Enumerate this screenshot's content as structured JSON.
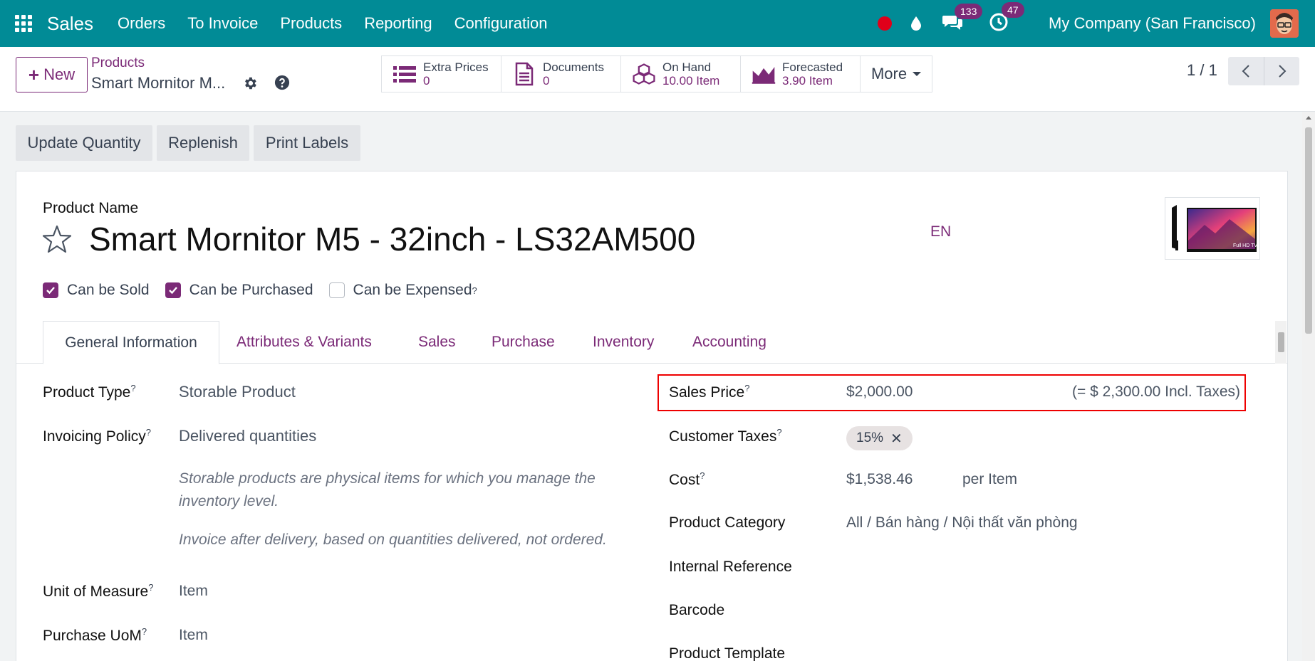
{
  "navbar": {
    "app_name": "Sales",
    "menu": [
      "Orders",
      "To Invoice",
      "Products",
      "Reporting",
      "Configuration"
    ],
    "messages_count": "133",
    "activities_count": "47",
    "company": "My Company (San Francisco)"
  },
  "control": {
    "new_label": "New",
    "breadcrumb_parent": "Products",
    "breadcrumb_current": "Smart Mornitor M...",
    "smart_buttons": [
      {
        "label": "Extra Prices",
        "value": "0",
        "icon": "list-icon"
      },
      {
        "label": "Documents",
        "value": "0",
        "icon": "document-icon"
      },
      {
        "label": "On Hand",
        "value": "10.00 Item",
        "icon": "cubes-icon"
      },
      {
        "label": "Forecasted",
        "value": "3.90 Item",
        "icon": "area-chart-icon"
      }
    ],
    "more_label": "More",
    "pager": "1 / 1"
  },
  "actions": [
    "Update Quantity",
    "Replenish",
    "Print Labels"
  ],
  "form": {
    "product_name_label": "Product Name",
    "product_name": "Smart Mornitor M5 - 32inch - LS32AM500",
    "lang": "EN",
    "image_caption": "Full HD TV",
    "checkboxes": [
      {
        "label": "Can be Sold",
        "checked": true
      },
      {
        "label": "Can be Purchased",
        "checked": true
      },
      {
        "label": "Can be Expensed",
        "checked": false
      }
    ],
    "tabs": [
      "General Information",
      "Attributes & Variants",
      "Sales",
      "Purchase",
      "Inventory",
      "Accounting"
    ],
    "left": {
      "product_type_label": "Product Type",
      "product_type": "Storable Product",
      "invoicing_policy_label": "Invoicing Policy",
      "invoicing_policy": "Delivered quantities",
      "help_storable": "Storable products are physical items for which you manage the inventory level.",
      "help_invoice": "Invoice after delivery, based on quantities delivered, not ordered.",
      "uom_label": "Unit of Measure",
      "uom": "Item",
      "purchase_uom_label": "Purchase UoM",
      "purchase_uom": "Item"
    },
    "right": {
      "sales_price_label": "Sales Price",
      "sales_price": "$2,000.00",
      "incl_taxes": "(= $ 2,300.00 Incl. Taxes)",
      "customer_taxes_label": "Customer Taxes",
      "customer_tax_tag": "15%",
      "cost_label": "Cost",
      "cost": "$1,538.46",
      "cost_unit": "per Item",
      "category_label": "Product Category",
      "category": "All / Bán hàng / Nội thất văn phòng",
      "internal_ref_label": "Internal Reference",
      "barcode_label": "Barcode",
      "template_label": "Product Template"
    }
  },
  "colors": {
    "navbar": "#018b96",
    "accent": "#7b2a77",
    "highlight": "#e00000",
    "record_dot": "#e0001a"
  }
}
